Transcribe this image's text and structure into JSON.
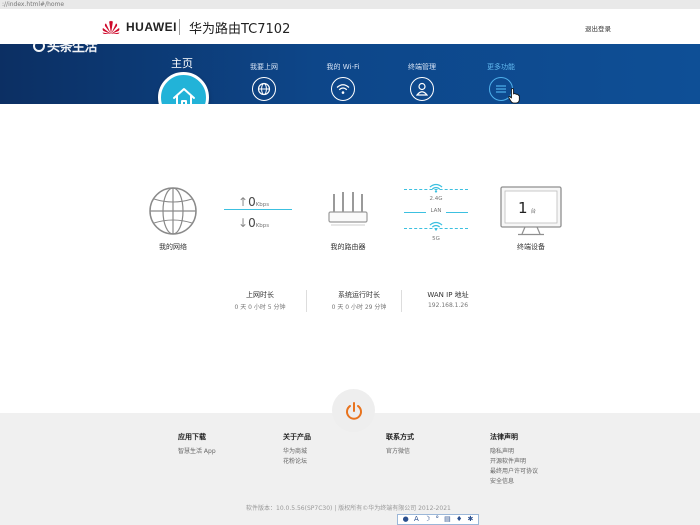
{
  "browser": {
    "url": "://index.html#/home"
  },
  "header": {
    "brand": "HUAWEI",
    "router_title": "华为路由TC7102",
    "logout": "退出登录",
    "watermark": "头条生活"
  },
  "nav": {
    "home": "主页",
    "items": [
      {
        "label": "我要上网",
        "icon": "globe-icon"
      },
      {
        "label": "我的 Wi-Fi",
        "icon": "wifi-icon"
      },
      {
        "label": "终端管理",
        "icon": "user-icon"
      },
      {
        "label": "更多功能",
        "icon": "menu-icon",
        "active": true
      }
    ]
  },
  "status": {
    "my_network": "我的网络",
    "upload_value": "0",
    "upload_unit": "Kbps",
    "download_value": "0",
    "download_unit": "Kbps",
    "my_router": "我的路由器",
    "band_24": "2.4G",
    "lan": "LAN",
    "band_5": "5G",
    "device_count": "1",
    "device_unit": "台",
    "terminal_devices": "终端设备"
  },
  "stats": [
    {
      "label": "上网时长",
      "value": "0 天 0 小时 5 分钟"
    },
    {
      "label": "系统运行时长",
      "value": "0 天 0 小时 29 分钟"
    },
    {
      "label": "WAN IP 地址",
      "value": "192.168.1.26"
    }
  ],
  "footer": {
    "columns": [
      {
        "title": "应用下载",
        "links": [
          "智慧生活 App"
        ]
      },
      {
        "title": "关于产品",
        "links": [
          "华为商城",
          "花粉论坛"
        ]
      },
      {
        "title": "联系方式",
        "links": [
          "官方微信"
        ]
      },
      {
        "title": "法律声明",
        "links": [
          "隐私声明",
          "开源软件声明",
          "最终用户许可协议",
          "安全信息"
        ]
      }
    ],
    "copyright": "软件版本：10.0.5.56(SP7C30) | 版权所有©华为终端有限公司 2012-2021"
  },
  "colors": {
    "nav_dark": "#0c2f63",
    "nav_light": "#0e4f96",
    "home_accent": "#22b3d8",
    "power_accent": "#e8731e",
    "huawei_red": "#cf0a2c",
    "wifi_teal": "#3cc0e0"
  }
}
